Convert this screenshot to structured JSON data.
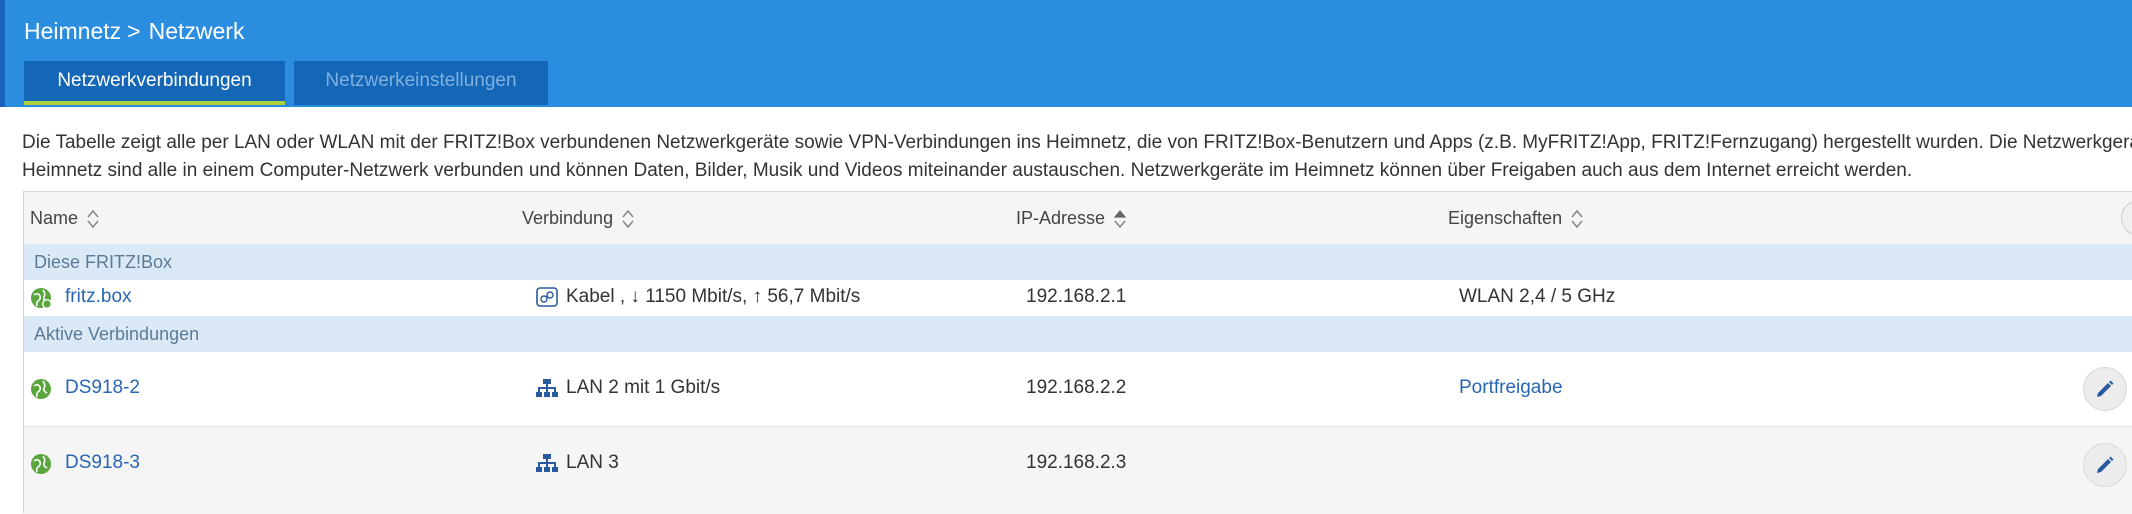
{
  "breadcrumb": {
    "parent": "Heimnetz",
    "separator": ">",
    "current": "Netzwerk"
  },
  "tabs": [
    {
      "label": "Netzwerkverbindungen",
      "active": true
    },
    {
      "label": "Netzwerkeinstellungen",
      "active": false
    }
  ],
  "description": {
    "line1": "Die Tabelle zeigt alle per LAN oder WLAN mit der FRITZ!Box verbundenen Netzwerkgeräte sowie VPN-Verbindungen ins Heimnetz, die von FRITZ!Box-Benutzern und Apps (z.B. MyFRITZ!App, FRITZ!Fernzugang) hergestellt wurden. Die Netzwerkgeräte im",
    "line2": "Heimnetz sind alle in einem Computer-Netzwerk verbunden und können Daten, Bilder, Musik und Videos miteinander austauschen. Netzwerkgeräte im Heimnetz können über Freigaben auch aus dem Internet erreicht werden."
  },
  "columns": [
    "Name",
    "Verbindung",
    "IP-Adresse",
    "Eigenschaften"
  ],
  "groups": {
    "box": "Diese FRITZ!Box",
    "active": "Aktive Verbindungen"
  },
  "rows": [
    {
      "name": "fritz.box",
      "connection": "Kabel , ↓ 1150 Mbit/s, ↑ 56,7 Mbit/s",
      "ip": "192.168.2.1",
      "properties": "WLAN 2,4 / 5 GHz",
      "connection_icon": "router-icon"
    },
    {
      "name": "DS918-2",
      "connection": "LAN 2 mit 1 Gbit/s",
      "ip": "192.168.2.2",
      "properties": "Portfreigabe",
      "connection_icon": "lan-icon"
    },
    {
      "name": "DS918-3",
      "connection": "LAN 3",
      "ip": "192.168.2.3",
      "properties": "",
      "connection_icon": "lan-icon"
    }
  ],
  "colors": {
    "header": "#2b8de0",
    "tab": "#1467b7",
    "tab_underline": "#aed13d",
    "group_bg": "#dbe9f7",
    "link": "#2866b4",
    "globe": "#5aa53c"
  }
}
